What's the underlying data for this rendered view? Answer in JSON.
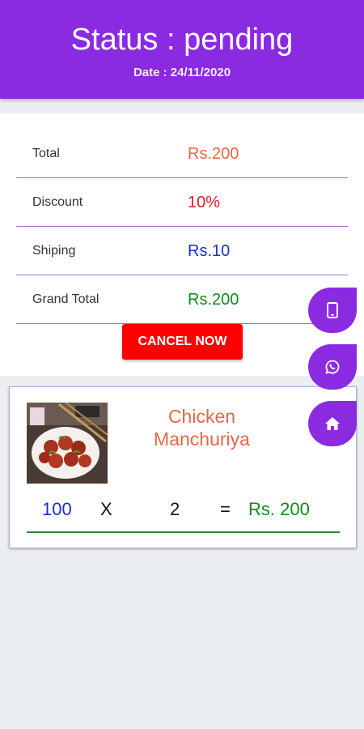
{
  "header": {
    "status": "Status : pending",
    "date": "Date : 24/11/2020"
  },
  "summary": {
    "rows": [
      {
        "label": "Total",
        "value": "Rs.200",
        "color": "#e4684a"
      },
      {
        "label": "Discount",
        "value": "10%",
        "color": "#d21f2b"
      },
      {
        "label": "Shiping",
        "value": "Rs.10",
        "color": "#1a2fc4"
      },
      {
        "label": "Grand Total",
        "value": "Rs.200",
        "color": "#118a1f"
      }
    ],
    "cancel_label": "CANCEL NOW"
  },
  "item": {
    "name_line1": "Chicken",
    "name_line2": "Manchuriya",
    "price": "100",
    "times": "X",
    "quantity": "2",
    "equals": "=",
    "subtotal": "Rs. 200"
  },
  "fab_icons": [
    "phone-icon",
    "whatsapp-icon",
    "home-icon"
  ],
  "colors": {
    "primary": "#8a2be2",
    "cancel": "#ff0000",
    "total": "#e4684a",
    "discount": "#d21f2b",
    "shipping": "#1a2fc4",
    "grand_total": "#118a1f",
    "item_name": "#e4684a",
    "price": "#1a2fc4",
    "subtotal": "#118a1f",
    "divider": "#2e8b2e",
    "background": "#eceff1"
  }
}
